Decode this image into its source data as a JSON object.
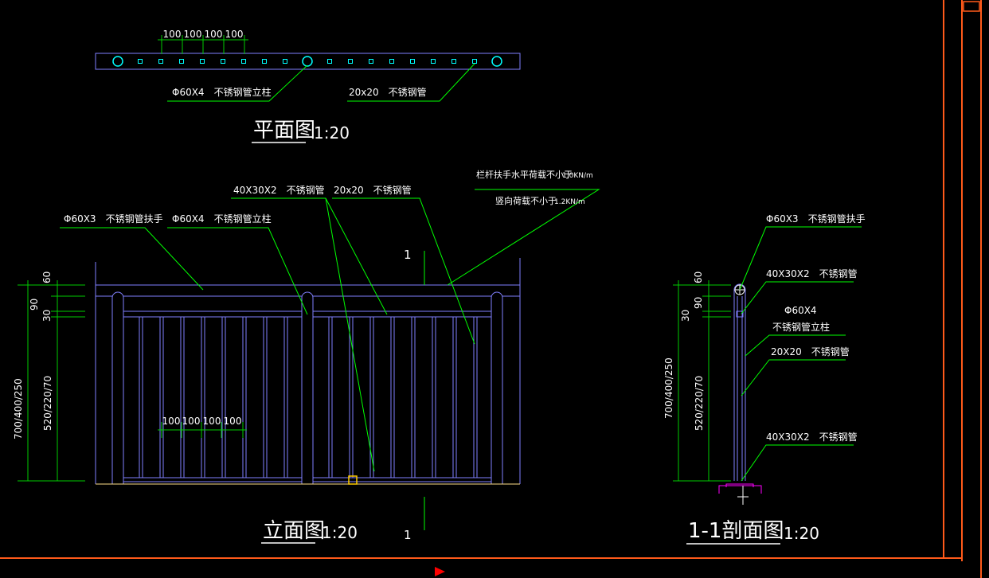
{
  "colors": {
    "background": "#000000",
    "outline": "#8080ff",
    "leader": "#00ff00",
    "dimension": "#00cc00",
    "text": "#ffffff",
    "post_circle": "#00ffff",
    "frame": "#ff5a1a",
    "base_plate": "#ff00ff",
    "ground": "#ffe08a",
    "grip": "#ffcc00",
    "cursor": "#ff0000"
  },
  "plan": {
    "dims": [
      "100",
      "100",
      "100",
      "100"
    ],
    "post_label": "Φ60X4　不锈钢管立柱",
    "bar_label": "20x20　不锈钢管",
    "title": "平面图",
    "scale": "1:20"
  },
  "elevation": {
    "handrail_label": "Φ60X3　不锈钢管扶手",
    "post_label": "Φ60X4　不锈钢管立柱",
    "rail_label": "40X30X2　不锈钢管",
    "bar_label": "20x20　不锈钢管",
    "load_horizontal": "栏杆扶手水平荷载不小于",
    "load_horizontal_value": "1.0KN/m",
    "load_vertical": "竖向荷载不小于",
    "load_vertical_value": "1.2KN/m",
    "section_mark_top": "1",
    "section_mark_bottom": "1",
    "dim_60": "60",
    "dim_90": "90",
    "dim_30": "30",
    "dim_total": "700/400/250",
    "dim_inner": "520/220/70",
    "spacing_dims": [
      "100",
      "100",
      "100",
      "100"
    ],
    "title": "立面图",
    "scale": "1:20"
  },
  "section": {
    "handrail_label": "Φ60X3　不锈钢管扶手",
    "rail_top_label": "40X30X2　不锈钢管",
    "post_label_1": "Φ60X4",
    "post_label_2": "不锈钢管立柱",
    "bar_label": "20X20　不锈钢管",
    "rail_bottom_label": "40X30X2　不锈钢管",
    "dim_60": "60",
    "dim_90": "90",
    "dim_30": "30",
    "dim_total": "700/400/250",
    "dim_inner": "520/220/70",
    "title": "1-1剖面图",
    "scale": "1:20"
  }
}
